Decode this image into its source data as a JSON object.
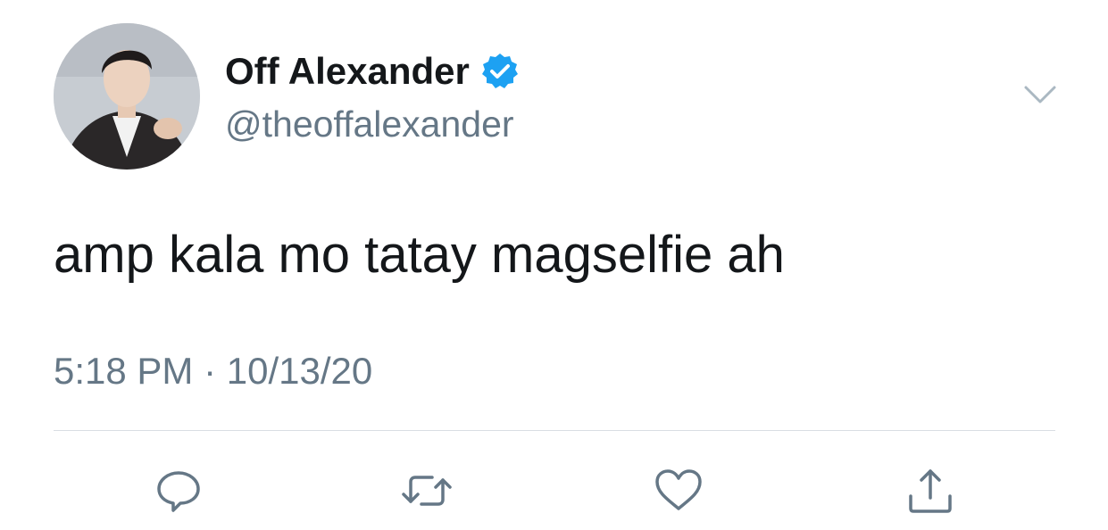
{
  "tweet": {
    "display_name": "Off Alexander",
    "handle": "@theoffalexander",
    "text": "amp kala mo tatay magselfie ah",
    "timestamp": "5:18 PM · 10/13/20",
    "verified": true
  },
  "icons": {
    "avatar": "profile-photo",
    "verified": "verified-badge-icon",
    "menu": "chevron-down-icon",
    "reply": "reply-icon",
    "retweet": "retweet-icon",
    "like": "heart-icon",
    "share": "share-icon"
  },
  "colors": {
    "text": "#14171a",
    "secondary": "#657786",
    "verified": "#1da1f2",
    "icon": "#657786",
    "divider": "#d9dee3"
  }
}
